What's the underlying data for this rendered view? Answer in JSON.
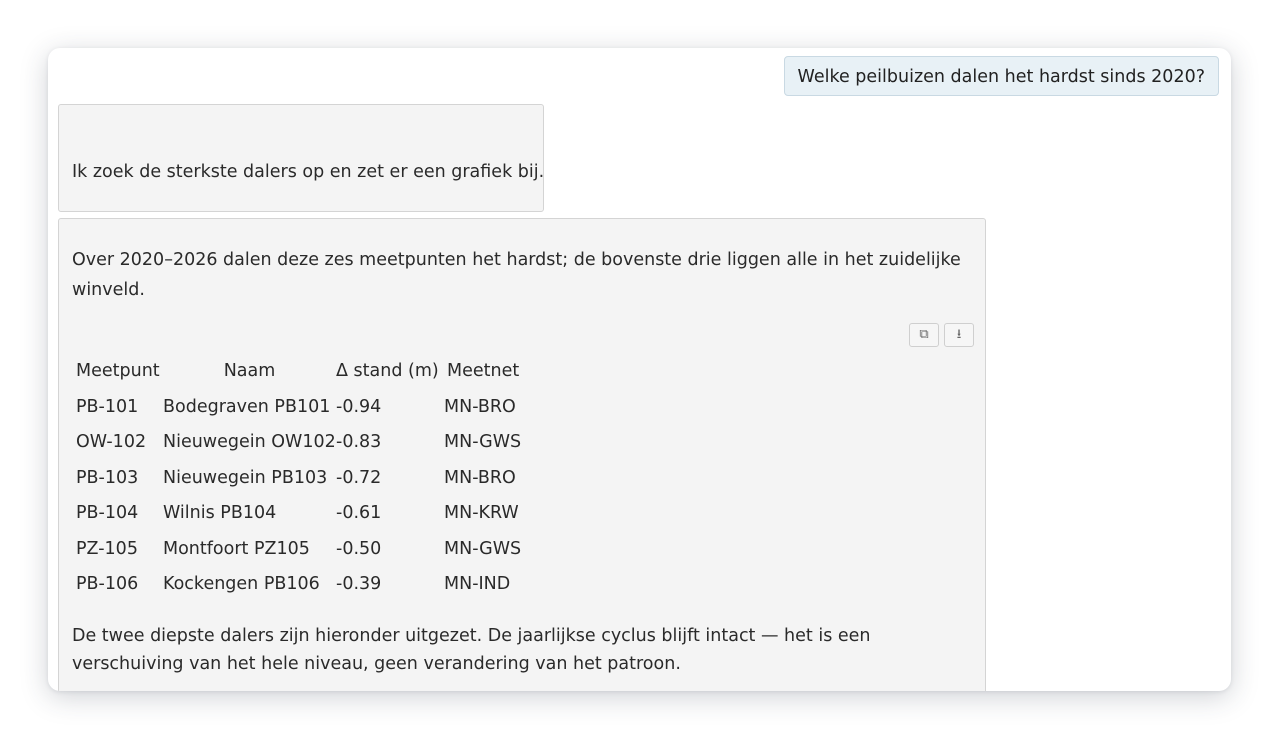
{
  "user_message": "Welke peilbuizen dalen het hardst sinds 2020?",
  "assistant_intro": "Ik zoek de sterkste dalers op en zet er een grafiek bij.",
  "answer": {
    "paragraph_1": "Over 2020–2026 dalen deze zes meetpunten het hardst; de bovenste drie liggen alle in het zuidelijke winveld.",
    "toolbar": {
      "copy_icon": "⧉",
      "download_icon": "⭳"
    },
    "table": {
      "headers": [
        "Meetpunt",
        "Naam",
        "Δ stand (m)",
        "Meetnet"
      ],
      "rows": [
        [
          "PB-101",
          "Bodegraven PB101",
          "-0.94",
          "MN-BRO"
        ],
        [
          "OW-102",
          "Nieuwegein OW102",
          "-0.83",
          "MN-GWS"
        ],
        [
          "PB-103",
          "Nieuwegein PB103",
          "-0.72",
          "MN-BRO"
        ],
        [
          "PB-104",
          "Wilnis PB104",
          "-0.61",
          "MN-KRW"
        ],
        [
          "PZ-105",
          "Montfoort PZ105",
          "-0.50",
          "MN-GWS"
        ],
        [
          "PB-106",
          "Kockengen PB106",
          "-0.39",
          "MN-IND"
        ]
      ]
    },
    "paragraph_2": "De twee diepste dalers zijn hieronder uitgezet. De jaarlijkse cyclus blijft intact — het is een verschuiving van het hele niveau, geen verandering van het patroon."
  }
}
